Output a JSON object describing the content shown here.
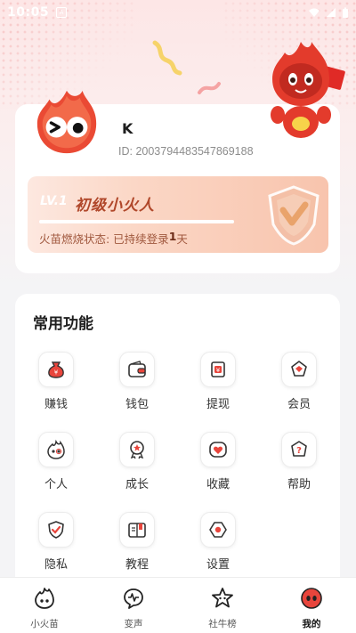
{
  "status_bar": {
    "time": "10:05",
    "notification_icon": "a-icon"
  },
  "profile": {
    "name": "K",
    "id_text": "ID: 2003794483547869188",
    "level": {
      "tag": "LV.1",
      "title": "初级小火人",
      "progress": 1.0,
      "status_prefix": "火苗燃烧状态: 已持续登录",
      "status_days": "1",
      "status_suffix": "天"
    }
  },
  "functions": {
    "title": "常用功能",
    "items": [
      {
        "label": "赚钱",
        "icon": "money-bag-icon"
      },
      {
        "label": "钱包",
        "icon": "wallet-icon"
      },
      {
        "label": "提现",
        "icon": "withdraw-icon"
      },
      {
        "label": "会员",
        "icon": "vip-diamond-icon"
      },
      {
        "label": "个人",
        "icon": "flame-face-icon"
      },
      {
        "label": "成长",
        "icon": "growth-medal-icon"
      },
      {
        "label": "收藏",
        "icon": "heart-favorite-icon"
      },
      {
        "label": "帮助",
        "icon": "help-icon"
      },
      {
        "label": "隐私",
        "icon": "privacy-shield-icon"
      },
      {
        "label": "教程",
        "icon": "tutorial-book-icon"
      },
      {
        "label": "设置",
        "icon": "settings-icon"
      }
    ]
  },
  "tabs": [
    {
      "label": "小火苗",
      "icon": "flame-icon",
      "active": false
    },
    {
      "label": "变声",
      "icon": "voice-change-icon",
      "active": false
    },
    {
      "label": "社牛榜",
      "icon": "star-rank-icon",
      "active": false
    },
    {
      "label": "我的",
      "icon": "profile-face-icon",
      "active": true
    }
  ],
  "colors": {
    "accent": "#e8453c",
    "level_text": "#b0472a",
    "background": "#f4f4f6"
  }
}
